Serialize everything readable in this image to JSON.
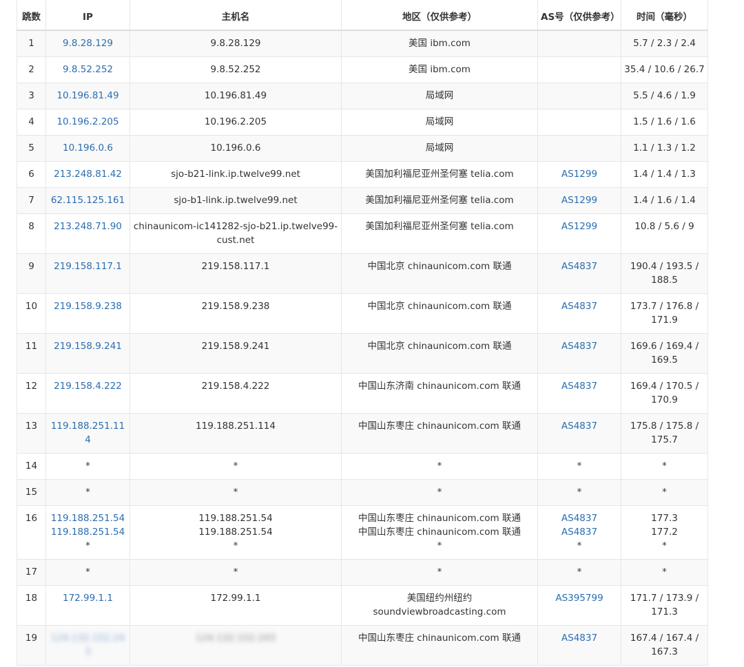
{
  "table": {
    "headers": {
      "hop": "跳数",
      "ip": "IP",
      "host": "主机名",
      "region": "地区（仅供参考）",
      "asn": "AS号（仅供参考）",
      "time": "时间（毫秒）"
    },
    "rows": [
      {
        "hop": "1",
        "ip": [
          "9.8.28.129"
        ],
        "host": [
          "9.8.28.129"
        ],
        "region": [
          "美国 ibm.com"
        ],
        "asn": [
          ""
        ],
        "time": [
          "5.7 / 2.3 / 2.4"
        ]
      },
      {
        "hop": "2",
        "ip": [
          "9.8.52.252"
        ],
        "host": [
          "9.8.52.252"
        ],
        "region": [
          "美国 ibm.com"
        ],
        "asn": [
          ""
        ],
        "time": [
          "35.4 / 10.6 / 26.7"
        ]
      },
      {
        "hop": "3",
        "ip": [
          "10.196.81.49"
        ],
        "host": [
          "10.196.81.49"
        ],
        "region": [
          "局域网"
        ],
        "asn": [
          ""
        ],
        "time": [
          "5.5 / 4.6 / 1.9"
        ]
      },
      {
        "hop": "4",
        "ip": [
          "10.196.2.205"
        ],
        "host": [
          "10.196.2.205"
        ],
        "region": [
          "局域网"
        ],
        "asn": [
          ""
        ],
        "time": [
          "1.5 / 1.6 / 1.6"
        ]
      },
      {
        "hop": "5",
        "ip": [
          "10.196.0.6"
        ],
        "host": [
          "10.196.0.6"
        ],
        "region": [
          "局域网"
        ],
        "asn": [
          ""
        ],
        "time": [
          "1.1 / 1.3 / 1.2"
        ]
      },
      {
        "hop": "6",
        "ip": [
          "213.248.81.42"
        ],
        "host": [
          "sjo-b21-link.ip.twelve99.net"
        ],
        "region": [
          "美国加利福尼亚州圣何塞 telia.com"
        ],
        "asn": [
          "AS1299"
        ],
        "time": [
          "1.4 / 1.4 / 1.3"
        ]
      },
      {
        "hop": "7",
        "ip": [
          "62.115.125.161"
        ],
        "host": [
          "sjo-b1-link.ip.twelve99.net"
        ],
        "region": [
          "美国加利福尼亚州圣何塞 telia.com"
        ],
        "asn": [
          "AS1299"
        ],
        "time": [
          "1.4 / 1.6 / 1.4"
        ]
      },
      {
        "hop": "8",
        "ip": [
          "213.248.71.90"
        ],
        "host": [
          "chinaunicom-ic141282-sjo-b21.ip.twelve99-cust.net"
        ],
        "region": [
          "美国加利福尼亚州圣何塞 telia.com"
        ],
        "asn": [
          "AS1299"
        ],
        "time": [
          "10.8 / 5.6 / 9"
        ]
      },
      {
        "hop": "9",
        "ip": [
          "219.158.117.1"
        ],
        "host": [
          "219.158.117.1"
        ],
        "region": [
          "中国北京 chinaunicom.com 联通"
        ],
        "asn": [
          "AS4837"
        ],
        "time": [
          "190.4 / 193.5 / 188.5"
        ]
      },
      {
        "hop": "10",
        "ip": [
          "219.158.9.238"
        ],
        "host": [
          "219.158.9.238"
        ],
        "region": [
          "中国北京 chinaunicom.com 联通"
        ],
        "asn": [
          "AS4837"
        ],
        "time": [
          "173.7 / 176.8 / 171.9"
        ]
      },
      {
        "hop": "11",
        "ip": [
          "219.158.9.241"
        ],
        "host": [
          "219.158.9.241"
        ],
        "region": [
          "中国北京 chinaunicom.com 联通"
        ],
        "asn": [
          "AS4837"
        ],
        "time": [
          "169.6 / 169.4 / 169.5"
        ]
      },
      {
        "hop": "12",
        "ip": [
          "219.158.4.222"
        ],
        "host": [
          "219.158.4.222"
        ],
        "region": [
          "中国山东济南 chinaunicom.com 联通"
        ],
        "asn": [
          "AS4837"
        ],
        "time": [
          "169.4 / 170.5 / 170.9"
        ]
      },
      {
        "hop": "13",
        "ip": [
          "119.188.251.114"
        ],
        "host": [
          "119.188.251.114"
        ],
        "region": [
          "中国山东枣庄 chinaunicom.com 联通"
        ],
        "asn": [
          "AS4837"
        ],
        "time": [
          "175.8 / 175.8 / 175.7"
        ]
      },
      {
        "hop": "14",
        "ip": [
          "*"
        ],
        "host": [
          "*"
        ],
        "region": [
          "*"
        ],
        "asn": [
          "*"
        ],
        "time": [
          "*"
        ]
      },
      {
        "hop": "15",
        "ip": [
          "*"
        ],
        "host": [
          "*"
        ],
        "region": [
          "*"
        ],
        "asn": [
          "*"
        ],
        "time": [
          "*"
        ]
      },
      {
        "hop": "16",
        "ip": [
          "119.188.251.54",
          "119.188.251.54",
          "*"
        ],
        "host": [
          "119.188.251.54",
          "119.188.251.54",
          "*"
        ],
        "region": [
          "中国山东枣庄 chinaunicom.com 联通",
          "中国山东枣庄 chinaunicom.com 联通",
          "*"
        ],
        "asn": [
          "AS4837",
          "AS4837",
          "*"
        ],
        "time": [
          "177.3",
          "177.2",
          "*"
        ]
      },
      {
        "hop": "17",
        "ip": [
          "*"
        ],
        "host": [
          "*"
        ],
        "region": [
          "*"
        ],
        "asn": [
          "*"
        ],
        "time": [
          "*"
        ]
      },
      {
        "hop": "18",
        "ip": [
          "172.99.1.1"
        ],
        "host": [
          "172.99.1.1"
        ],
        "region": [
          "美国纽约州纽约 soundviewbroadcasting.com"
        ],
        "asn": [
          "AS395799"
        ],
        "time": [
          "171.7 / 173.9 / 171.3"
        ]
      },
      {
        "hop": "19",
        "ip": [
          "124.132.152.243"
        ],
        "host": [
          "124.132.152.243"
        ],
        "region": [
          "中国山东枣庄 chinaunicom.com 联通"
        ],
        "asn": [
          "AS4837"
        ],
        "time": [
          "167.4 / 167.4 / 167.3"
        ],
        "redacted": true
      }
    ]
  }
}
